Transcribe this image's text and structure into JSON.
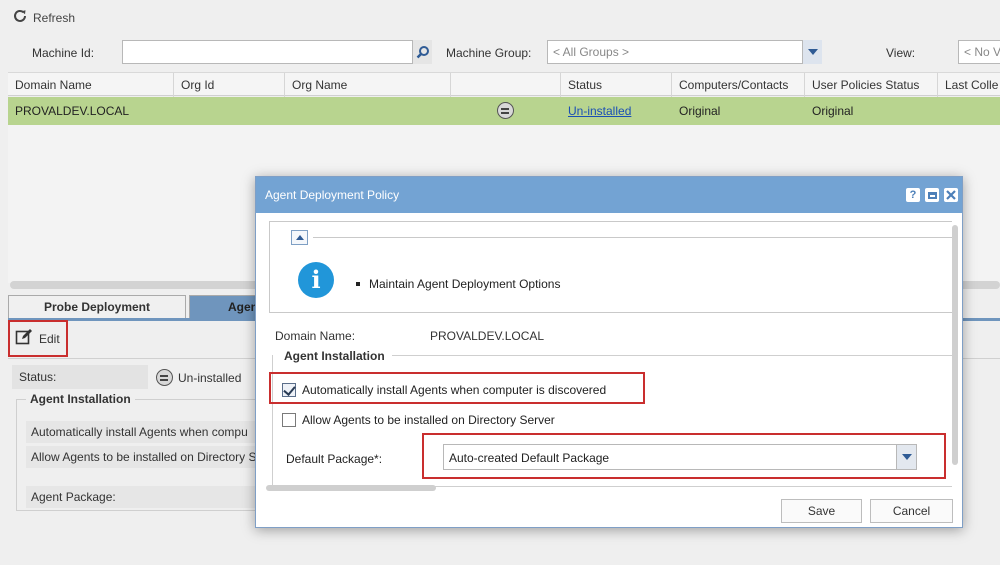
{
  "toolbar": {
    "refresh_label": "Refresh",
    "refresh_icon": "refresh-icon"
  },
  "filters": {
    "machine_id_label": "Machine Id:",
    "machine_id_value": "",
    "machine_group_label": "Machine Group:",
    "machine_group_value": "< All Groups >",
    "view_label": "View:",
    "view_value": "< No V"
  },
  "grid": {
    "columns": [
      "Domain Name",
      "Org Id",
      "Org Name",
      "",
      "Status",
      "Computers/Contacts",
      "User Policies Status",
      "Last Colle"
    ],
    "row": {
      "domain_name": "PROVALDEV.LOCAL",
      "org_id": "",
      "org_name": "",
      "status": "Un-installed",
      "computers_contacts": "Original",
      "user_policies_status": "Original"
    },
    "selected_row_color": "#b8d48f"
  },
  "tabs": [
    {
      "label": "Probe Deployment",
      "active": false
    },
    {
      "label": "Agen",
      "active": true
    }
  ],
  "detail": {
    "edit_label": "Edit",
    "status_label": "Status:",
    "status_value": "Un-installed",
    "section_title": "Agent Installation",
    "row1": "Automatically install Agents when compu",
    "row2": "Allow Agents to be installed on Directory S",
    "row3": "Agent Package:"
  },
  "modal": {
    "title": "Agent Deployment Policy",
    "help_btn": "?",
    "info_text": "Maintain Agent Deployment Options",
    "domain_label": "Domain Name:",
    "domain_value": "PROVALDEV.LOCAL",
    "section_title": "Agent Installation",
    "auto_install_label": "Automatically install Agents when computer is discovered",
    "auto_install_checked": true,
    "allow_directory_label": "Allow Agents to be installed on Directory Server",
    "allow_directory_checked": false,
    "package_label": "Default Package*:",
    "package_value": "Auto-created Default Package",
    "save_label": "Save",
    "cancel_label": "Cancel",
    "header_color": "#73a3d3",
    "highlight_color": "#c92e2e"
  }
}
